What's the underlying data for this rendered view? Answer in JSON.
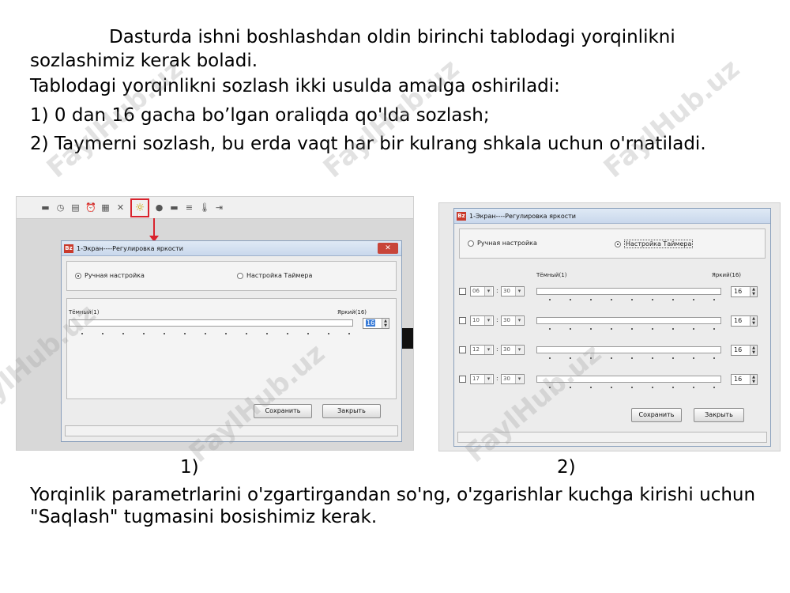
{
  "document": {
    "intro_line1": "Dasturda ishni boshlashdan oldin birinchi tablodagi yorqinlikni",
    "intro_line2": "sozlashimiz kerak boladi.",
    "methods_intro": "Tablodagi yorqinlikni sozlash ikki usulda amalga oshiriladi:",
    "method_1": "1) 0 dan 16 gacha bo’lgan oraliqda qo'lda sozlash;",
    "method_2": "2) Taymerni sozlash, bu erda vaqt har bir kulrang shkala uchun o'rnatiladi.",
    "caption_1": "1)",
    "caption_2": "2)",
    "outro_line1": "Yorqinlik parametrlarini o'zgartirgandan so'ng, o'zgarishlar kuchga kirishi uchun",
    "outro_line2": "\"Saqlash\" tugmasini bosishimiz kerak."
  },
  "watermark": "FaylHub.uz",
  "screenshot1": {
    "toolbar_icons": [
      "record-icon",
      "clock-icon",
      "calendar-icon",
      "alarm-icon",
      "grid-icon",
      "delete-icon",
      "brightness-icon",
      "circle-icon",
      "list-icon",
      "list-alt-icon",
      "thermometer-icon",
      "export-icon"
    ],
    "toolbar_glyphs": [
      "▬",
      "◷",
      "▤",
      "⏰",
      "▦",
      "✕",
      "☼",
      "●",
      "▬",
      "≡",
      "🌡",
      "⇥"
    ],
    "window_title": "1-Экран----Регулировка яркости",
    "close_glyph": "✕",
    "app_icon_text": "Bz",
    "radio_manual": "Ручная настройка",
    "radio_timer": "Настройка Таймера",
    "label_dark": "Тёмный(1)",
    "label_bright": "Яркий(16)",
    "brightness_value": "16",
    "save_button": "Сохранить",
    "close_button": "Закрыть"
  },
  "screenshot2": {
    "window_title": "1-Экран----Регулировка яркости",
    "app_icon_text": "Bz",
    "radio_manual": "Ручная настройка",
    "radio_timer": "Настройка Таймера",
    "label_dark": "Тёмный(1)",
    "label_bright": "Яркий(16)",
    "timer_rows": [
      {
        "hour": "06",
        "minute": "30",
        "value": "16"
      },
      {
        "hour": "10",
        "minute": "30",
        "value": "16"
      },
      {
        "hour": "12",
        "minute": "30",
        "value": "16"
      },
      {
        "hour": "17",
        "minute": "30",
        "value": "16"
      }
    ],
    "separator": ":",
    "save_button": "Сохранить",
    "close_button": "Закрыть"
  },
  "colors": {
    "highlight_red": "#d9232d",
    "title_bar": "#c9d8ec",
    "selection_blue": "#3b7dd8"
  }
}
